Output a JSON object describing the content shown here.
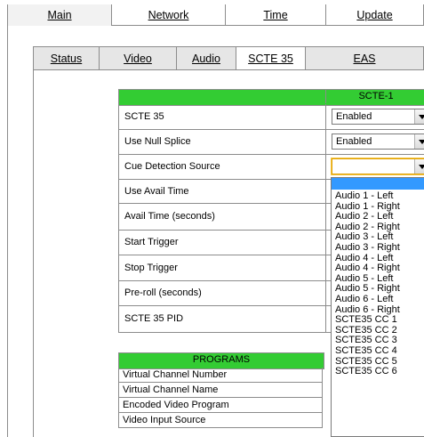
{
  "main_nav": {
    "tabs": [
      "Main",
      "Network",
      "Time",
      "Update"
    ]
  },
  "sub_nav": {
    "tabs": [
      "Status",
      "Video",
      "Audio",
      "SCTE 35",
      "EAS"
    ]
  },
  "scte_table": {
    "column_header": "SCTE-1",
    "rows": [
      {
        "label": "SCTE 35",
        "value": "Enabled"
      },
      {
        "label": "Use Null Splice",
        "value": "Enabled"
      },
      {
        "label": "Cue Detection Source",
        "value": ""
      },
      {
        "label": "Use Avail Time"
      },
      {
        "label": "Avail Time (seconds)"
      },
      {
        "label": "Start Trigger"
      },
      {
        "label": "Stop Trigger"
      },
      {
        "label": "Pre-roll (seconds)"
      },
      {
        "label": "SCTE 35 PID"
      }
    ]
  },
  "dropdown": {
    "options": [
      "",
      "Audio 1 - Left",
      "Audio 1 - Right",
      "Audio 2 - Left",
      "Audio 2 - Right",
      "Audio 3 - Left",
      "Audio 3 - Right",
      "Audio 4 - Left",
      "Audio 4 - Right",
      "Audio 5 - Left",
      "Audio 5 - Right",
      "Audio 6 - Left",
      "Audio 6 - Right",
      "SCTE35 CC 1",
      "SCTE35 CC 2",
      "SCTE35 CC 3",
      "SCTE35 CC 4",
      "SCTE35 CC 5",
      "SCTE35 CC 6"
    ]
  },
  "programs_table": {
    "header": "PROGRAMS",
    "rows": [
      "Virtual Channel Number",
      "Virtual Channel Name",
      "Encoded Video Program",
      "Video Input Source"
    ]
  },
  "colors": {
    "header_green": "#33cc33",
    "selection_blue": "#3399ff"
  }
}
